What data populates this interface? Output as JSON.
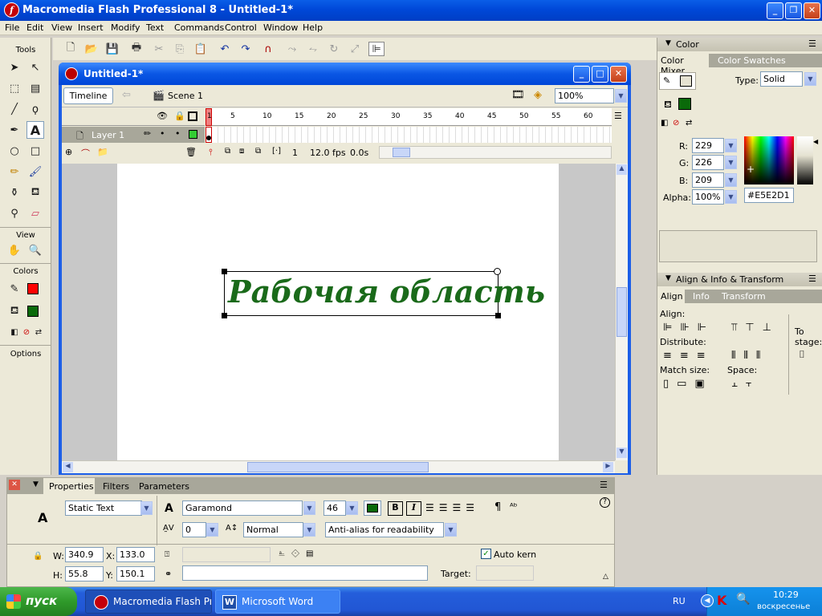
{
  "window": {
    "title": "Macromedia Flash Professional 8 - Untitled-1*",
    "app_icon": "f"
  },
  "menu": [
    "File",
    "Edit",
    "View",
    "Insert",
    "Modify",
    "Text",
    "Commands",
    "Control",
    "Window",
    "Help"
  ],
  "tools": {
    "header": "Tools",
    "view_label": "View",
    "colors_label": "Colors",
    "options_label": "Options"
  },
  "document": {
    "title": "Untitled-1*",
    "timeline_button": "Timeline",
    "scene": "Scene 1",
    "zoom": "100%"
  },
  "timeline": {
    "layer": "Layer 1",
    "frame_numbers": [
      "1",
      "5",
      "10",
      "15",
      "20",
      "25",
      "30",
      "35",
      "40",
      "45",
      "50",
      "55",
      "60"
    ],
    "current_frame": "1",
    "fps": "12.0 fps",
    "time": "0.0s"
  },
  "stage": {
    "text": "Рабочая область",
    "text_color": "#1a6a1a"
  },
  "color_panel": {
    "header": "Color",
    "tabs": [
      "Color Mixer",
      "Color Swatches"
    ],
    "type_label": "Type:",
    "type_value": "Solid",
    "r_label": "R:",
    "r": "229",
    "g_label": "G:",
    "g": "226",
    "b_label": "B:",
    "b": "209",
    "alpha_label": "Alpha:",
    "alpha": "100%",
    "hex": "#E5E2D1"
  },
  "align_panel": {
    "header": "Align & Info & Transform",
    "tabs": [
      "Align",
      "Info",
      "Transform"
    ],
    "align_label": "Align:",
    "distribute_label": "Distribute:",
    "match_label": "Match size:",
    "space_label": "Space:",
    "to_stage_label": "To stage:"
  },
  "properties": {
    "tabs": [
      "Properties",
      "Filters",
      "Parameters"
    ],
    "text_type": "Static Text",
    "font": "Garamond",
    "size": "46",
    "letter_spacing": "0",
    "char_position": "Normal",
    "anti_alias": "Anti-alias for readability",
    "w_label": "W:",
    "w": "340.9",
    "x_label": "X:",
    "x": "133.0",
    "h_label": "H:",
    "h": "55.8",
    "y_label": "Y:",
    "y": "150.1",
    "auto_kern": "Auto kern",
    "target_label": "Target:",
    "fill_color": "#0a6a0a"
  },
  "taskbar": {
    "start": "пуск",
    "tasks": [
      "Macromedia Flash Pr...",
      "Microsoft Word"
    ],
    "lang": "RU",
    "time": "10:29",
    "day": "воскресенье"
  }
}
